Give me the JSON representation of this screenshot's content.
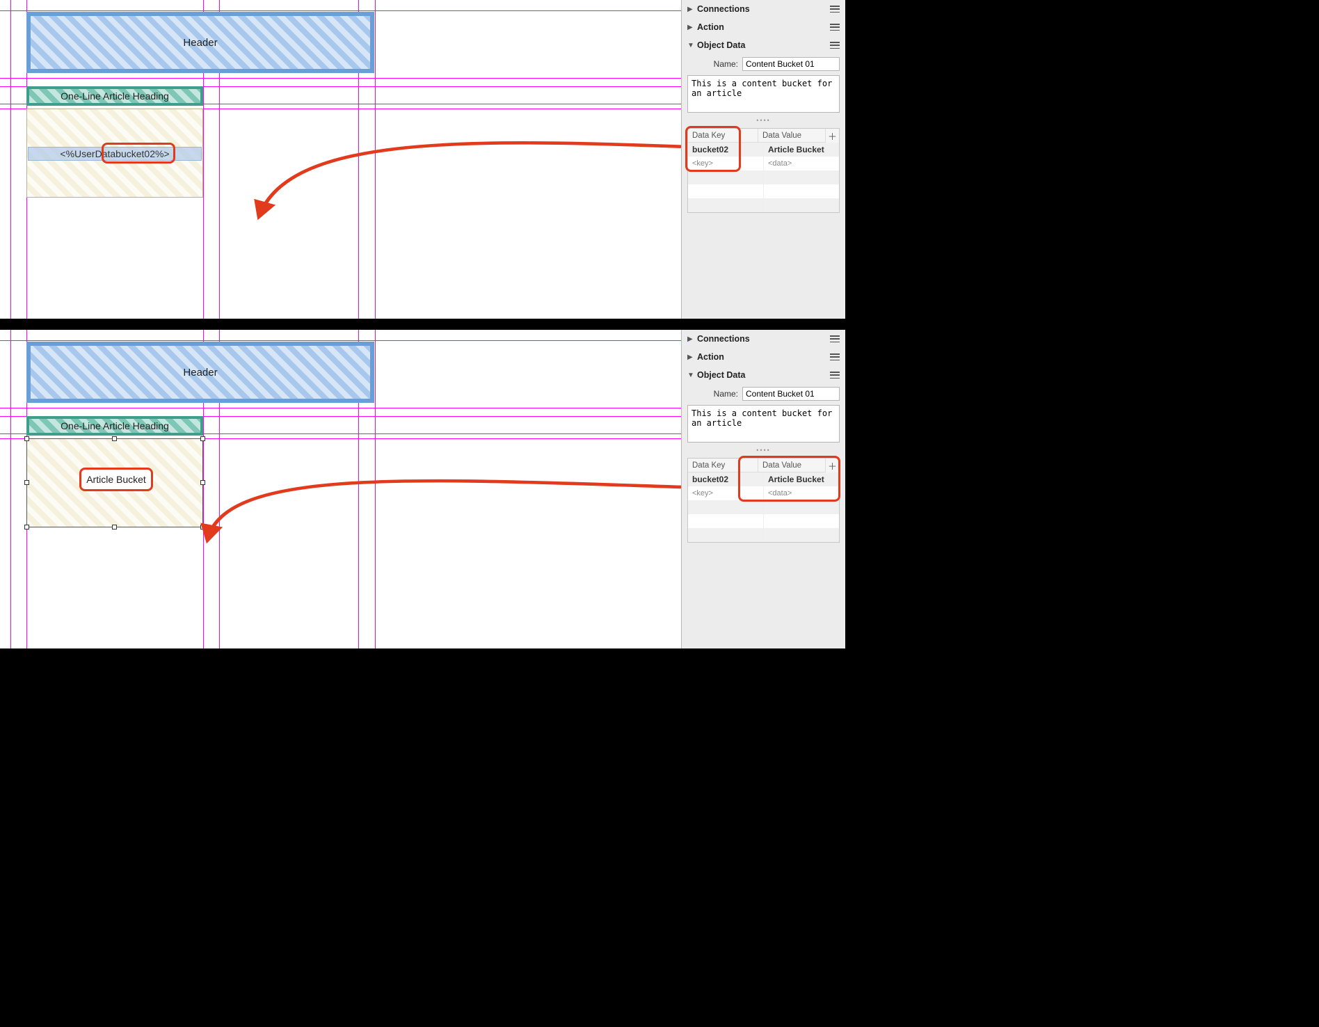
{
  "top": {
    "canvas": {
      "header_label": "Header",
      "heading_label": "One-Line Article Heading",
      "field_prefix": "<%UserData ",
      "field_key": "bucket02",
      "field_suffix": "%>"
    },
    "inspector": {
      "connections_label": "Connections",
      "action_label": "Action",
      "object_data_label": "Object Data",
      "name_label": "Name:",
      "name_value": "Content Bucket 01",
      "description_value": "This is a content bucket for an article",
      "kv": {
        "key_header": "Data Key",
        "value_header": "Data Value",
        "key": "bucket02",
        "value": "Article Bucket",
        "key_hint": "<key>",
        "value_hint": "<data>"
      }
    }
  },
  "bottom": {
    "canvas": {
      "header_label": "Header",
      "heading_label": "One-Line Article Heading",
      "field_value": "Article Bucket"
    },
    "inspector": {
      "connections_label": "Connections",
      "action_label": "Action",
      "object_data_label": "Object Data",
      "name_label": "Name:",
      "name_value": "Content Bucket 01",
      "description_value": "This is a content bucket for an article",
      "kv": {
        "key_header": "Data Key",
        "value_header": "Data Value",
        "key": "bucket02",
        "value": "Article Bucket",
        "key_hint": "<key>",
        "value_hint": "<data>"
      }
    }
  }
}
